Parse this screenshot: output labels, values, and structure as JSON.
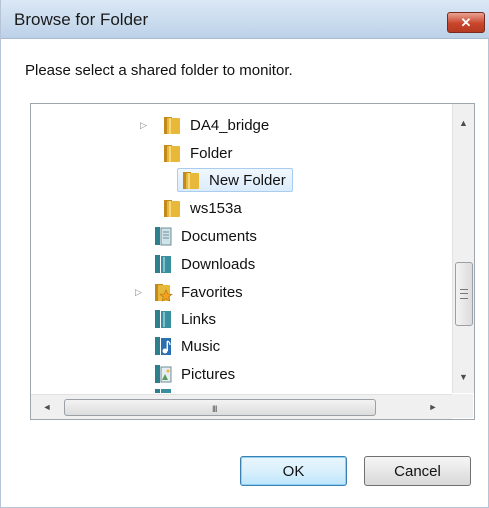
{
  "window": {
    "title": "Browse for Folder",
    "close_glyph": "✕"
  },
  "prompt": "Please select a shared folder to monitor.",
  "tree": {
    "items": [
      {
        "label": "DA4_bridge",
        "icon": "folder-icon",
        "expandable": true,
        "selected": false
      },
      {
        "label": "Folder",
        "icon": "folder-icon",
        "expandable": false,
        "selected": false
      },
      {
        "label": "New Folder",
        "icon": "folder-icon",
        "expandable": false,
        "selected": true
      },
      {
        "label": "ws153a",
        "icon": "folder-icon",
        "expandable": false,
        "selected": false
      },
      {
        "label": "Documents",
        "icon": "library-documents-icon",
        "expandable": false,
        "selected": false
      },
      {
        "label": "Downloads",
        "icon": "library-downloads-icon",
        "expandable": false,
        "selected": false
      },
      {
        "label": "Favorites",
        "icon": "favorites-star-folder-icon",
        "expandable": true,
        "selected": false
      },
      {
        "label": "Links",
        "icon": "library-links-icon",
        "expandable": false,
        "selected": false
      },
      {
        "label": "Music",
        "icon": "music-icon",
        "expandable": false,
        "selected": false
      },
      {
        "label": "Pictures",
        "icon": "pictures-icon",
        "expandable": false,
        "selected": false
      }
    ]
  },
  "scrollbars": {
    "vertical": {
      "up_glyph": "▲",
      "down_glyph": "▼",
      "grip": "≡"
    },
    "horizontal": {
      "left_glyph": "◄",
      "right_glyph": "►",
      "grip": "III"
    }
  },
  "buttons": {
    "ok": "OK",
    "cancel": "Cancel"
  },
  "colors": {
    "titlebar": "#c9dbee",
    "close": "#c9452b",
    "selection": "#dcecfc",
    "folder": "#e8b83a"
  }
}
